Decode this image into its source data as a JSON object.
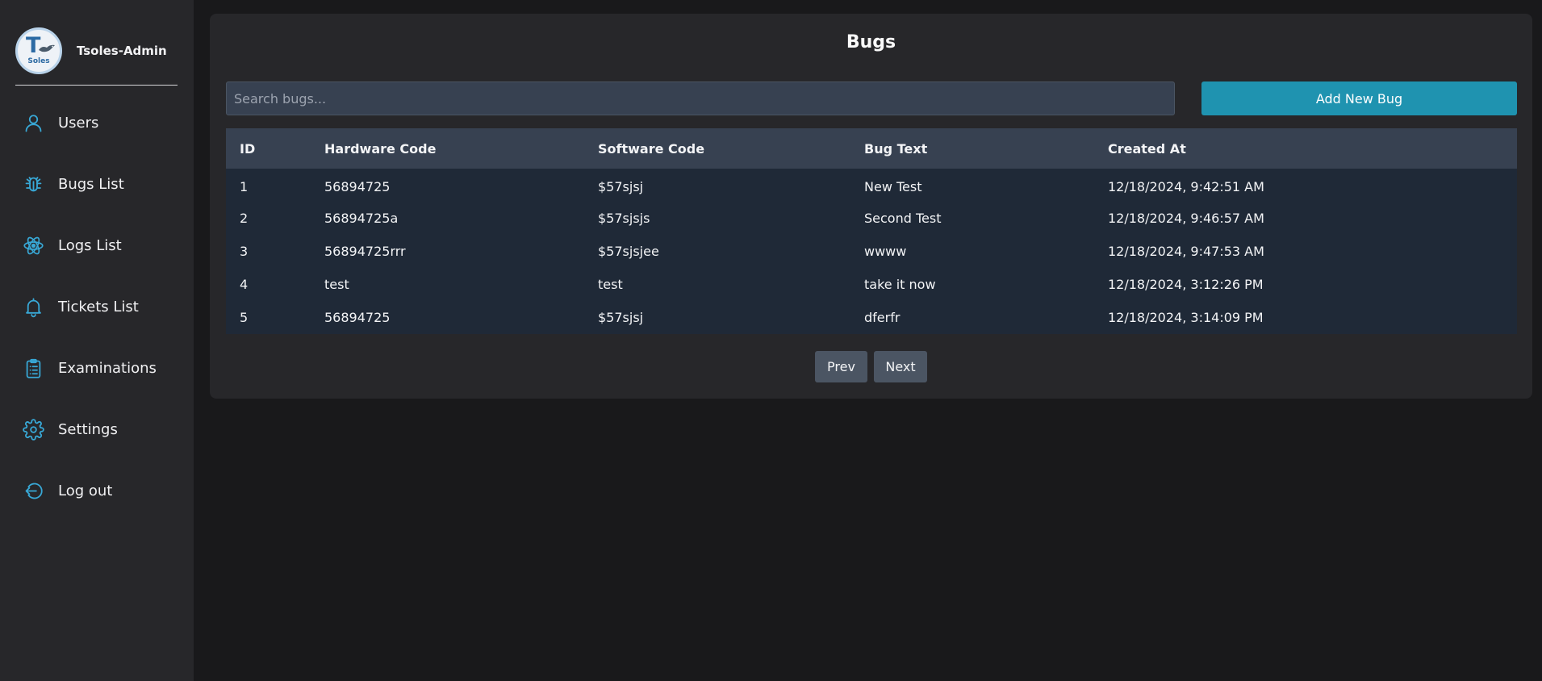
{
  "app": {
    "name": "Tsoles-Admin",
    "logo_letter": "T",
    "logo_subtext": "Soles"
  },
  "colors": {
    "accent": "#1f93b0",
    "icon": "#38a8d6",
    "sidebar_bg": "#27272a",
    "page_bg": "#19191b",
    "table_header_bg": "#374151",
    "table_body_bg": "#1f2937"
  },
  "sidebar": {
    "items": [
      {
        "label": "Users",
        "icon": "user-icon"
      },
      {
        "label": "Bugs List",
        "icon": "bug-icon"
      },
      {
        "label": "Logs List",
        "icon": "atom-icon"
      },
      {
        "label": "Tickets List",
        "icon": "bell-icon"
      },
      {
        "label": "Examinations",
        "icon": "clipboard-list-icon"
      },
      {
        "label": "Settings",
        "icon": "gear-icon"
      },
      {
        "label": "Log out",
        "icon": "logout-icon"
      }
    ]
  },
  "main": {
    "title": "Bugs",
    "search": {
      "placeholder": "Search bugs...",
      "value": ""
    },
    "add_button": "Add New Bug",
    "table": {
      "headers": [
        "ID",
        "Hardware Code",
        "Software Code",
        "Bug Text",
        "Created At"
      ],
      "rows": [
        [
          "1",
          "56894725",
          "$57sjsj",
          "New Test",
          "12/18/2024, 9:42:51 AM"
        ],
        [
          "2",
          "56894725a",
          "$57sjsjs",
          "Second Test",
          "12/18/2024, 9:46:57 AM"
        ],
        [
          "3",
          "56894725rrr",
          "$57sjsjee",
          "wwww",
          "12/18/2024, 9:47:53 AM"
        ],
        [
          "4",
          "test",
          "test",
          "take it now",
          "12/18/2024, 3:12:26 PM"
        ],
        [
          "5",
          "56894725",
          "$57sjsj",
          "dferfr",
          "12/18/2024, 3:14:09 PM"
        ]
      ]
    },
    "pagination": {
      "prev": "Prev",
      "next": "Next"
    }
  }
}
